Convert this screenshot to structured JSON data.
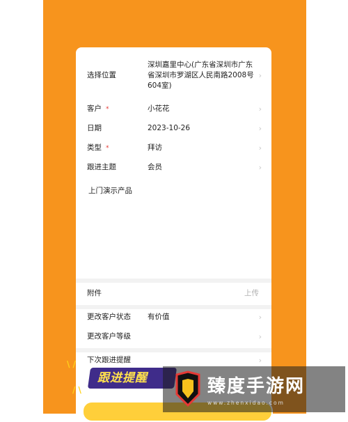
{
  "form": {
    "location": {
      "label": "选择位置",
      "value_lines": [
        "深圳嘉里中心(广东省深圳市广东",
        "省深圳市罗湖区人民南路2008号",
        "604室)"
      ]
    },
    "customer": {
      "label": "客户",
      "required": "*",
      "value": "小花花"
    },
    "date": {
      "label": "日期",
      "value": "2023-10-26"
    },
    "type": {
      "label": "类型",
      "required": "*",
      "value": "拜访"
    },
    "topic": {
      "label": "跟进主题",
      "value": "会员"
    },
    "content_text": "上门演示产品",
    "attachment": {
      "label": "附件",
      "action": "上传"
    },
    "customer_status": {
      "label": "更改客户状态",
      "value": "有价值"
    },
    "customer_level": {
      "label": "更改客户等级"
    },
    "next_reminder": {
      "label": "下次跟进提醒"
    }
  },
  "banner": {
    "text": "跟进提醒"
  },
  "watermark": {
    "text": "臻度手游网",
    "url": "www.zhenxidao.com"
  },
  "icons": {
    "chevron": "chevron-right-icon"
  },
  "colors": {
    "background": "#f7941d",
    "required": "#e53935",
    "banner": "#3f2c8a",
    "banner_text": "#ffe14d"
  }
}
